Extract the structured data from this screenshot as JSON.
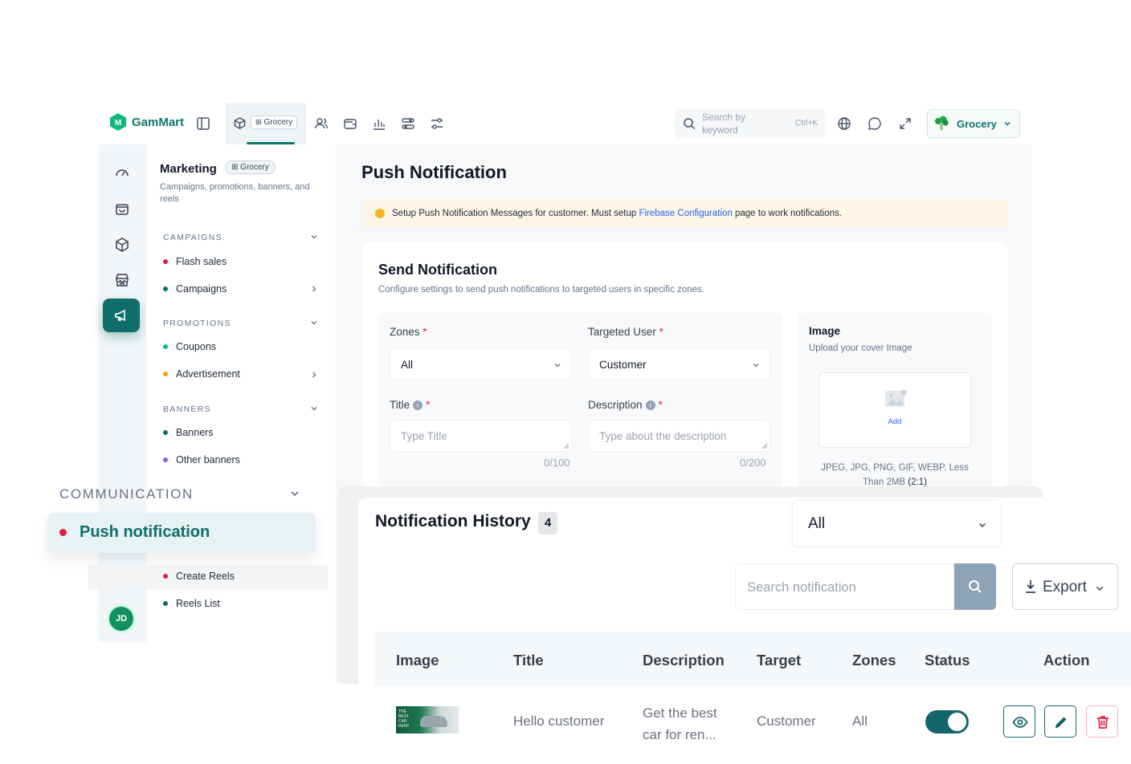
{
  "app": {
    "name": "GamMart"
  },
  "topbar": {
    "module_chip": "Grocery",
    "search_placeholder": "Search by keyword",
    "search_shortcut": "Ctrl+K",
    "store_label": "Grocery"
  },
  "sidebar_rail": {
    "avatar_initials": "JD"
  },
  "menu": {
    "title": "Marketing",
    "chip": "Grocery",
    "subtitle": "Campaigns, promotions, banners, and reels",
    "sections": {
      "campaigns": "CAMPAIGNS",
      "promotions": "PROMOTIONS",
      "banners": "BANNERS",
      "communication": "COMMUNICATION"
    },
    "items": {
      "flash_sales": "Flash sales",
      "campaigns": "Campaigns",
      "coupons": "Coupons",
      "advertisement": "Advertisement",
      "banners": "Banners",
      "other_banners": "Other banners",
      "push_notification": "Push notification",
      "create_reels": "Create Reels",
      "reels_list": "Reels List"
    },
    "colors": {
      "red": "#e11d48",
      "green": "#10b981",
      "orange": "#f59e0b",
      "teal": "#0f6e6a",
      "purple": "#8b5cf6"
    }
  },
  "main": {
    "title": "Push Notification",
    "notice": {
      "before": "Setup Push Notification Messages for customer. Must setup ",
      "link": "Firebase Configuration",
      "after": " page to work notifications."
    },
    "send": {
      "title": "Send Notification",
      "subtitle": "Configure settings to send push notifications to targeted users in specific zones.",
      "zones_label": "Zones",
      "zones_value": "All",
      "target_label": "Targeted User",
      "target_value": "Customer",
      "title_label": "Title",
      "title_placeholder": "Type Title",
      "title_count": "0/100",
      "desc_label": "Description",
      "desc_placeholder": "Type about the description",
      "desc_count": "0/200",
      "required_mark": "*",
      "info_mark": "i"
    },
    "image": {
      "title": "Image",
      "subtitle": "Upload your cover Image",
      "add_label": "Add",
      "hint": "JPEG, JPG, PNG, GIF, WEBP. Less Than 2MB",
      "ratio": "(2:1)"
    }
  },
  "history": {
    "title": "Notification History",
    "count": "4",
    "filter_value": "All",
    "search_placeholder": "Search notification",
    "export_label": "Export",
    "columns": [
      "Image",
      "Title",
      "Description",
      "Target",
      "Zones",
      "Status",
      "Action"
    ],
    "rows": [
      {
        "thumb_text": "THE BEST CAR RENT",
        "title": "Hello customer",
        "description": "Get the best car for ren...",
        "target": "Customer",
        "zones": "All",
        "status_on": true
      }
    ],
    "action_colors": {
      "view": "#13666b",
      "edit": "#13666b",
      "delete": "#e11d48"
    }
  }
}
